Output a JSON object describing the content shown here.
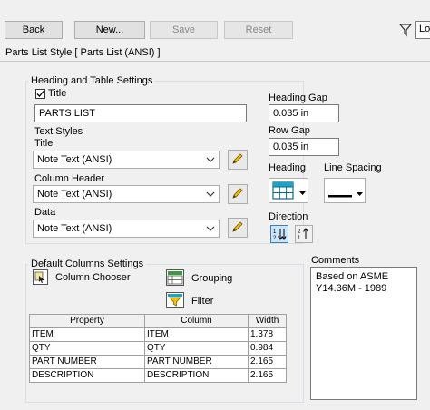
{
  "toolbar": {
    "back": "Back",
    "new": "New...",
    "save": "Save",
    "reset": "Reset",
    "filter_icon": "filter-icon",
    "search_partial": "Lo"
  },
  "style_header": "Parts List Style [ Parts List (ANSI) ]",
  "heading_group": {
    "title": "Heading and Table Settings",
    "title_checkbox_label": "Title",
    "title_checked": true,
    "title_value": "PARTS LIST",
    "text_styles_title": "Text Styles",
    "title_style_label": "Title",
    "title_style_value": "Note Text (ANSI)",
    "column_header_label": "Column Header",
    "column_header_value": "Note Text (ANSI)",
    "data_label": "Data",
    "data_value": "Note Text (ANSI)",
    "heading_gap_label": "Heading Gap",
    "heading_gap_value": "0.035 in",
    "row_gap_label": "Row Gap",
    "row_gap_value": "0.035 in",
    "heading_label": "Heading",
    "line_spacing_label": "Line Spacing",
    "direction_label": "Direction"
  },
  "columns_group": {
    "title": "Default Columns Settings",
    "column_chooser": "Column Chooser",
    "grouping": "Grouping",
    "filter": "Filter",
    "headers": [
      "Property",
      "Column",
      "Width"
    ],
    "rows": [
      [
        "ITEM",
        "ITEM",
        "1.378"
      ],
      [
        "QTY",
        "QTY",
        "0.984"
      ],
      [
        "PART NUMBER",
        "PART NUMBER",
        "2.165"
      ],
      [
        "DESCRIPTION",
        "DESCRIPTION",
        "2.165"
      ]
    ]
  },
  "comments": {
    "label": "Comments",
    "text": "Based on ASME Y14.36M - 1989"
  }
}
